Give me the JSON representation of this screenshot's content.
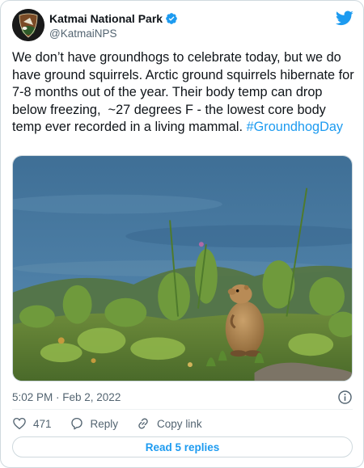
{
  "author": {
    "display_name": "Katmai National Park",
    "handle": "@KatmaiNPS",
    "verified": true
  },
  "tweet": {
    "text": "We don’t have groundhogs to celebrate today, but we do have ground squirrels. Arctic ground squirrels hibernate for 7-8 months out of the year. Their body temp can drop below freezing,  ~27 degrees F - the lowest core body temp ever recorded in a living mammal. ",
    "hashtag": "#GroundhogDay",
    "timestamp": "5:02 PM · Feb 2, 2022"
  },
  "actions": {
    "like_count": "471",
    "reply_label": "Reply",
    "copy_link_label": "Copy link"
  },
  "read_replies_label": "Read 5 replies",
  "icons": {
    "brand": "twitter-bird-icon",
    "verified": "verified-badge-icon",
    "info": "info-icon",
    "like": "heart-icon",
    "reply": "speech-bubble-icon",
    "copy_link": "link-icon"
  },
  "colors": {
    "accent": "#1d9bf0",
    "text": "#0f1419",
    "secondary": "#536471",
    "border": "#cfd9de"
  }
}
